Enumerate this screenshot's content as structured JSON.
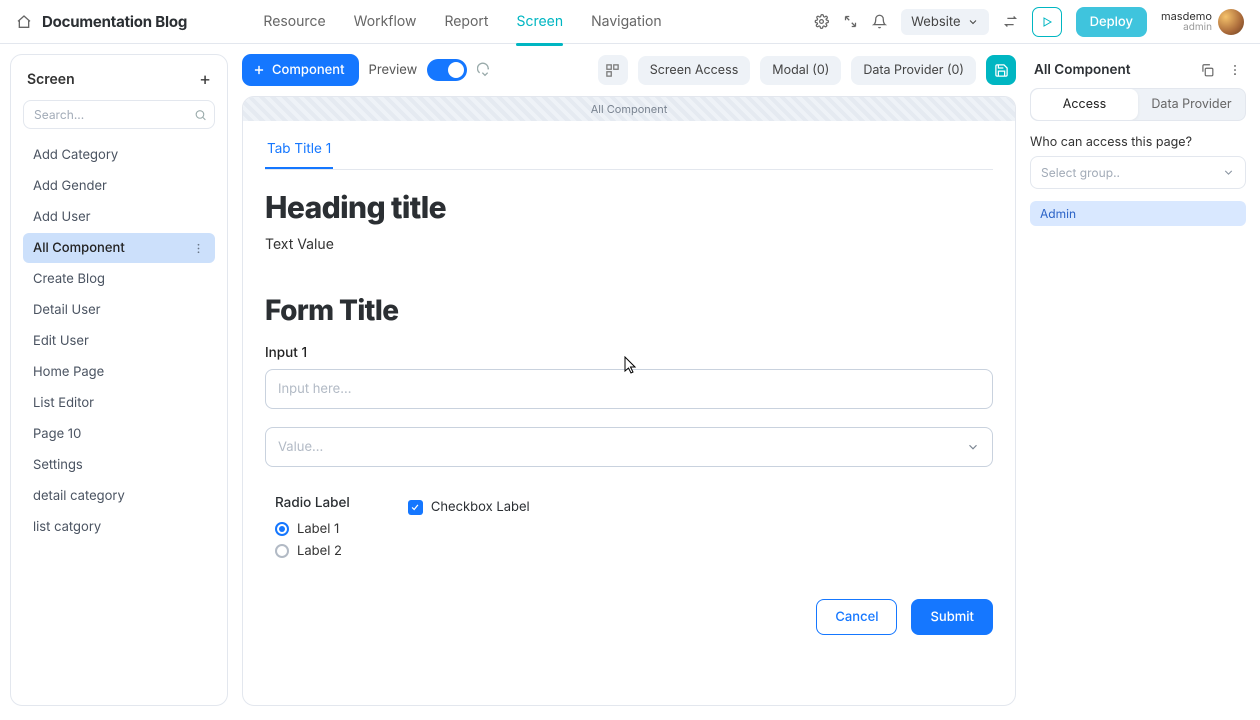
{
  "header": {
    "title": "Documentation Blog",
    "nav": [
      "Resource",
      "Workflow",
      "Report",
      "Screen",
      "Navigation"
    ],
    "nav_active_index": 3,
    "env_dropdown": "Website",
    "deploy_label": "Deploy",
    "user": {
      "name": "masdemo",
      "role": "admin"
    }
  },
  "sidebar": {
    "title": "Screen",
    "search_placeholder": "Search...",
    "items": [
      "Add Category",
      "Add Gender",
      "Add User",
      "All Component",
      "Create Blog",
      "Detail User",
      "Edit User",
      "Home Page",
      "List Editor",
      "Page 10",
      "Settings",
      "detail category",
      "list catgory"
    ],
    "selected_index": 3
  },
  "toolbar": {
    "add_component": "Component",
    "preview": "Preview",
    "screen_access": "Screen Access",
    "modal": "Modal (0)",
    "data_provider": "Data Provider (0)"
  },
  "canvas": {
    "breadcrumb": "All Component",
    "tab_title": "Tab Title 1",
    "heading": "Heading title",
    "text_value": "Text Value",
    "form_title": "Form Title",
    "input_label": "Input 1",
    "input_placeholder": "Input here...",
    "select_placeholder": "Value...",
    "radio_group_label": "Radio Label",
    "radio_options": [
      "Label 1",
      "Label 2"
    ],
    "radio_selected_index": 0,
    "checkbox_label": "Checkbox Label",
    "checkbox_checked": true,
    "cancel": "Cancel",
    "submit": "Submit"
  },
  "inspector": {
    "title": "All Component",
    "tabs": [
      "Access",
      "Data Provider"
    ],
    "tab_active_index": 0,
    "access_question": "Who can access this page?",
    "select_placeholder": "Select group..",
    "chip": "Admin"
  }
}
